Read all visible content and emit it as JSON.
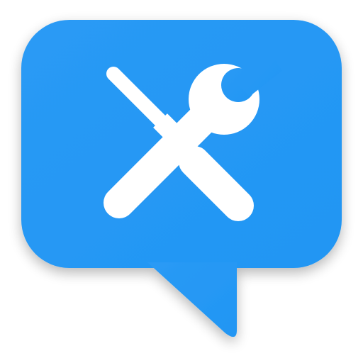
{
  "icon": {
    "name": "support-tools-chat-icon",
    "glyphs": [
      "speech-bubble-icon",
      "screwdriver-icon",
      "wrench-icon"
    ],
    "colors": {
      "bubble": "#2196F3",
      "bubble_highlight": "#2a9af5",
      "tools": "#ffffff",
      "background": "#ffffff"
    }
  }
}
